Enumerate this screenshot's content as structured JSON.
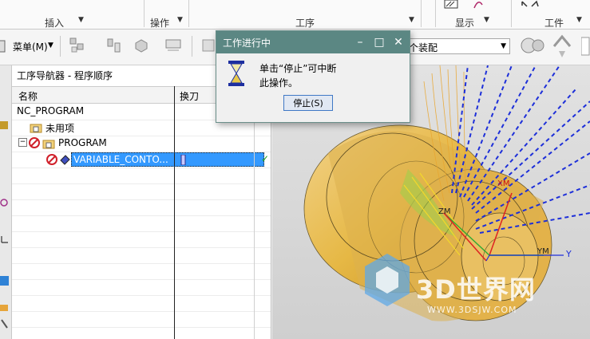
{
  "ribbon": {
    "groups": [
      "插入",
      "操作",
      "工序",
      "显示",
      "工件"
    ]
  },
  "toolbar": {
    "menu_label": "菜单(M)",
    "assembly_select": "个装配"
  },
  "navigator": {
    "title": "工序导航器 - 程序顺序",
    "columns": [
      "名称",
      "换刀"
    ],
    "rows": [
      {
        "label": "NC_PROGRAM"
      },
      {
        "label": "未用项"
      },
      {
        "label": "PROGRAM"
      },
      {
        "label": "VARIABLE_CONTO..."
      }
    ]
  },
  "dialog": {
    "title": "工作进行中",
    "message_line1": "单击“停止”可中断",
    "message_line2": "此操作。",
    "stop_button": "停止(S)"
  },
  "viewport": {
    "axis_x": "XM",
    "axis_z": "ZM",
    "axis_y": "YM",
    "axis_y2": "Y",
    "watermark": "3D世界网",
    "watermark_url": "WWW.3DSJW.COM"
  },
  "colors": {
    "dialog_title_bg": "#5b8783",
    "selection_bg": "#3399ff",
    "part_gold": "#e6b845",
    "toolpath_blue": "#1d2fd9"
  }
}
